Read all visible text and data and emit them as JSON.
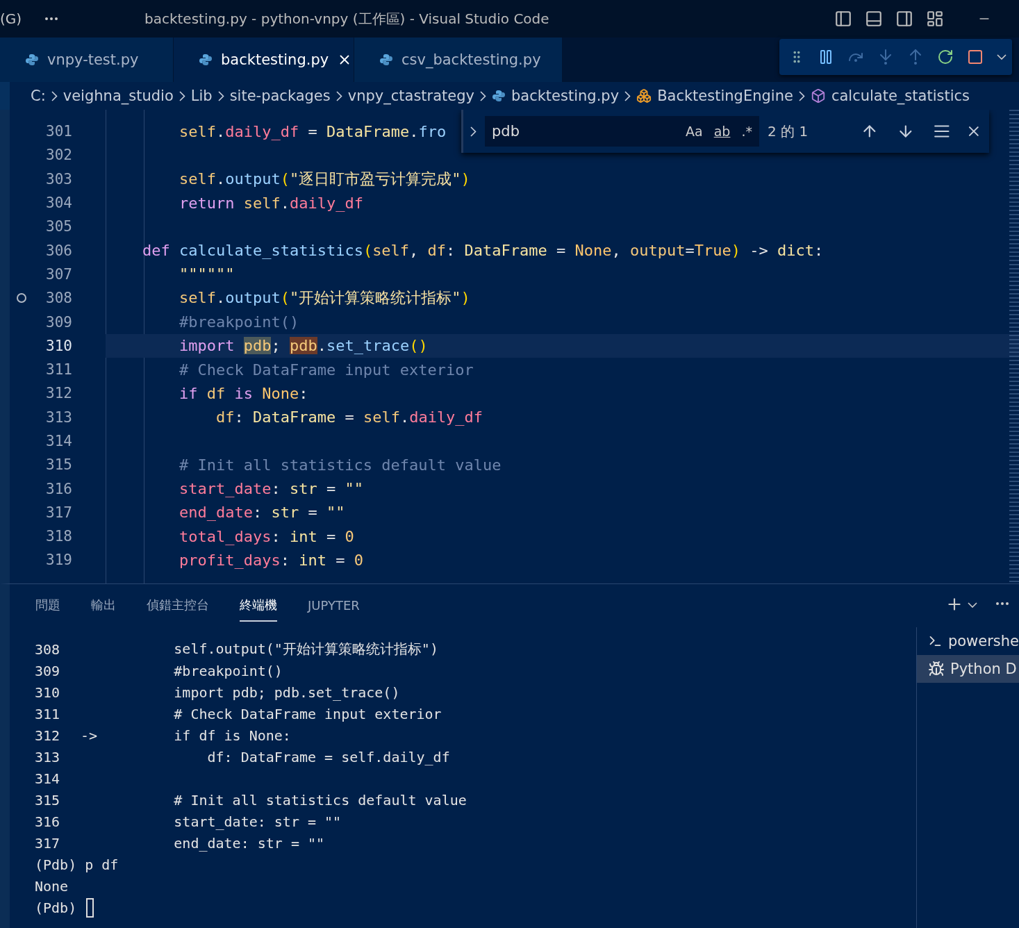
{
  "menu_fragment": "(G)",
  "window": {
    "title": "backtesting.py - python-vnpy (工作區) - Visual Studio Code"
  },
  "tabs": [
    {
      "label": "vnpy-test.py",
      "selected": false
    },
    {
      "label": "backtesting.py",
      "selected": true
    },
    {
      "label": "csv_backtesting.py",
      "selected": false
    }
  ],
  "breadcrumbs": [
    {
      "label": "C:",
      "kind": "folder"
    },
    {
      "label": "veighna_studio",
      "kind": "folder"
    },
    {
      "label": "Lib",
      "kind": "folder"
    },
    {
      "label": "site-packages",
      "kind": "folder"
    },
    {
      "label": "vnpy_ctastrategy",
      "kind": "folder"
    },
    {
      "label": "backtesting.py",
      "kind": "file"
    },
    {
      "label": "BacktestingEngine",
      "kind": "class"
    },
    {
      "label": "calculate_statistics",
      "kind": "method"
    }
  ],
  "find": {
    "value": "pdb",
    "toggles": [
      "Aa",
      "ab",
      ".*"
    ],
    "count": "2 的 1"
  },
  "code_lines": [
    {
      "number": "301",
      "breakpoint": false,
      "current": false,
      "tokens": [
        {
          "kind": "self",
          "text": "        self"
        },
        {
          "kind": "op",
          "text": "."
        },
        {
          "kind": "attr",
          "text": "daily_df"
        },
        {
          "kind": "op",
          "text": " = "
        },
        {
          "kind": "cls",
          "text": "DataFrame"
        },
        {
          "kind": "op",
          "text": "."
        },
        {
          "kind": "fn",
          "text": "fro"
        }
      ]
    },
    {
      "number": "302",
      "breakpoint": false,
      "current": false
    },
    {
      "number": "303",
      "breakpoint": false,
      "current": false,
      "tokens": [
        {
          "kind": "self",
          "text": "        self"
        },
        {
          "kind": "op",
          "text": "."
        },
        {
          "kind": "fn",
          "text": "output"
        },
        {
          "kind": "paren",
          "text": "("
        },
        {
          "kind": "str",
          "text": "\"逐日盯市盈亏计算完成\""
        },
        {
          "kind": "paren",
          "text": ")"
        }
      ]
    },
    {
      "number": "304",
      "breakpoint": false,
      "current": false,
      "tokens": [
        {
          "kind": "kw",
          "text": "        return "
        },
        {
          "kind": "self",
          "text": "self"
        },
        {
          "kind": "op",
          "text": "."
        },
        {
          "kind": "attr",
          "text": "daily_df"
        }
      ]
    },
    {
      "number": "305",
      "breakpoint": false,
      "current": false
    },
    {
      "number": "306",
      "breakpoint": false,
      "current": false,
      "tokens": [
        {
          "kind": "kw",
          "text": "    def "
        },
        {
          "kind": "fn",
          "text": "calculate_statistics"
        },
        {
          "kind": "paren",
          "text": "("
        },
        {
          "kind": "self",
          "text": "self"
        },
        {
          "kind": "op",
          "text": ", "
        },
        {
          "kind": "self",
          "text": "df"
        },
        {
          "kind": "op",
          "text": ": "
        },
        {
          "kind": "cls",
          "text": "DataFrame"
        },
        {
          "kind": "op",
          "text": " = "
        },
        {
          "kind": "const",
          "text": "None"
        },
        {
          "kind": "op",
          "text": ", "
        },
        {
          "kind": "self",
          "text": "output"
        },
        {
          "kind": "op",
          "text": "="
        },
        {
          "kind": "const",
          "text": "True"
        },
        {
          "kind": "paren",
          "text": ")"
        },
        {
          "kind": "op",
          "text": " -> "
        },
        {
          "kind": "cls",
          "text": "dict"
        },
        {
          "kind": "op",
          "text": ":"
        }
      ]
    },
    {
      "number": "307",
      "breakpoint": false,
      "current": false,
      "tokens": [
        {
          "kind": "str",
          "text": "        \"\"\"\"\"\""
        }
      ]
    },
    {
      "number": "308",
      "breakpoint": true,
      "current": false,
      "tokens": [
        {
          "kind": "self",
          "text": "        self"
        },
        {
          "kind": "op",
          "text": "."
        },
        {
          "kind": "fn",
          "text": "output"
        },
        {
          "kind": "paren",
          "text": "("
        },
        {
          "kind": "str",
          "text": "\"开始计算策略统计指标\""
        },
        {
          "kind": "paren",
          "text": ")"
        }
      ]
    },
    {
      "number": "309",
      "breakpoint": false,
      "current": false,
      "tokens": [
        {
          "kind": "cmt",
          "text": "        #breakpoint()"
        }
      ]
    },
    {
      "number": "310",
      "breakpoint": false,
      "current": true,
      "tokens": [
        {
          "kind": "kw",
          "text": "        import "
        },
        {
          "kind": "match",
          "text": "pdb"
        },
        {
          "kind": "op",
          "text": "; "
        },
        {
          "kind": "curmatch",
          "text": "pdb"
        },
        {
          "kind": "op",
          "text": "."
        },
        {
          "kind": "fn",
          "text": "set_trace"
        },
        {
          "kind": "paren",
          "text": "()"
        }
      ]
    },
    {
      "number": "311",
      "breakpoint": false,
      "current": false,
      "tokens": [
        {
          "kind": "cmt",
          "text": "        # Check DataFrame input exterior"
        }
      ]
    },
    {
      "number": "312",
      "breakpoint": false,
      "current": false,
      "tokens": [
        {
          "kind": "kw",
          "text": "        if "
        },
        {
          "kind": "self",
          "text": "df "
        },
        {
          "kind": "kw",
          "text": "is "
        },
        {
          "kind": "const",
          "text": "None"
        },
        {
          "kind": "op",
          "text": ":"
        }
      ]
    },
    {
      "number": "313",
      "breakpoint": false,
      "current": false,
      "tokens": [
        {
          "kind": "self",
          "text": "            df"
        },
        {
          "kind": "op",
          "text": ": "
        },
        {
          "kind": "cls",
          "text": "DataFrame"
        },
        {
          "kind": "op",
          "text": " = "
        },
        {
          "kind": "self",
          "text": "self"
        },
        {
          "kind": "op",
          "text": "."
        },
        {
          "kind": "attr",
          "text": "daily_df"
        }
      ]
    },
    {
      "number": "314",
      "breakpoint": false,
      "current": false
    },
    {
      "number": "315",
      "breakpoint": false,
      "current": false,
      "tokens": [
        {
          "kind": "cmt",
          "text": "        # Init all statistics default value"
        }
      ]
    },
    {
      "number": "316",
      "breakpoint": false,
      "current": false,
      "tokens": [
        {
          "kind": "attr",
          "text": "        start_date"
        },
        {
          "kind": "op",
          "text": ": "
        },
        {
          "kind": "cls",
          "text": "str"
        },
        {
          "kind": "op",
          "text": " = "
        },
        {
          "kind": "str",
          "text": "\"\""
        }
      ]
    },
    {
      "number": "317",
      "breakpoint": false,
      "current": false,
      "tokens": [
        {
          "kind": "attr",
          "text": "        end_date"
        },
        {
          "kind": "op",
          "text": ": "
        },
        {
          "kind": "cls",
          "text": "str"
        },
        {
          "kind": "op",
          "text": " = "
        },
        {
          "kind": "str",
          "text": "\"\""
        }
      ]
    },
    {
      "number": "318",
      "breakpoint": false,
      "current": false,
      "tokens": [
        {
          "kind": "attr",
          "text": "        total_days"
        },
        {
          "kind": "op",
          "text": ": "
        },
        {
          "kind": "cls",
          "text": "int"
        },
        {
          "kind": "op",
          "text": " = "
        },
        {
          "kind": "num",
          "text": "0"
        }
      ]
    },
    {
      "number": "319",
      "breakpoint": false,
      "current": false,
      "tokens": [
        {
          "kind": "attr",
          "text": "        profit_days"
        },
        {
          "kind": "op",
          "text": ": "
        },
        {
          "kind": "cls",
          "text": "int"
        },
        {
          "kind": "op",
          "text": " = "
        },
        {
          "kind": "num",
          "text": "0"
        }
      ]
    }
  ],
  "panel_tabs": [
    {
      "label": "問題",
      "selected": false
    },
    {
      "label": "輸出",
      "selected": false
    },
    {
      "label": "偵錯主控台",
      "selected": false
    },
    {
      "label": "終端機",
      "selected": true
    },
    {
      "label": "JUPYTER",
      "selected": false
    }
  ],
  "terminal_lines": [
    {
      "kind": "source",
      "line": "308",
      "code": "        self.output(\"开始计算策略统计指标\")"
    },
    {
      "kind": "source",
      "line": "309",
      "code": "        #breakpoint()"
    },
    {
      "kind": "source",
      "line": "310",
      "code": "        import pdb; pdb.set_trace()"
    },
    {
      "kind": "source",
      "line": "311",
      "code": "        # Check DataFrame input exterior"
    },
    {
      "kind": "source",
      "line": "312",
      "marker": "->",
      "code": "        if df is None:"
    },
    {
      "kind": "source",
      "line": "313",
      "code": "            df: DataFrame = self.daily_df"
    },
    {
      "kind": "source",
      "line": "314"
    },
    {
      "kind": "source",
      "line": "315",
      "code": "        # Init all statistics default value"
    },
    {
      "kind": "source",
      "line": "316",
      "code": "        start_date: str = \"\""
    },
    {
      "kind": "source",
      "line": "317",
      "code": "        end_date: str = \"\""
    },
    {
      "kind": "output",
      "text": "(Pdb) p df"
    },
    {
      "kind": "output",
      "text": "None"
    },
    {
      "kind": "prompt",
      "text": "(Pdb)"
    }
  ],
  "terminals": [
    {
      "label": "powershe",
      "kind": "shell",
      "selected": false
    },
    {
      "label": "Python D",
      "kind": "debug",
      "selected": true
    }
  ]
}
